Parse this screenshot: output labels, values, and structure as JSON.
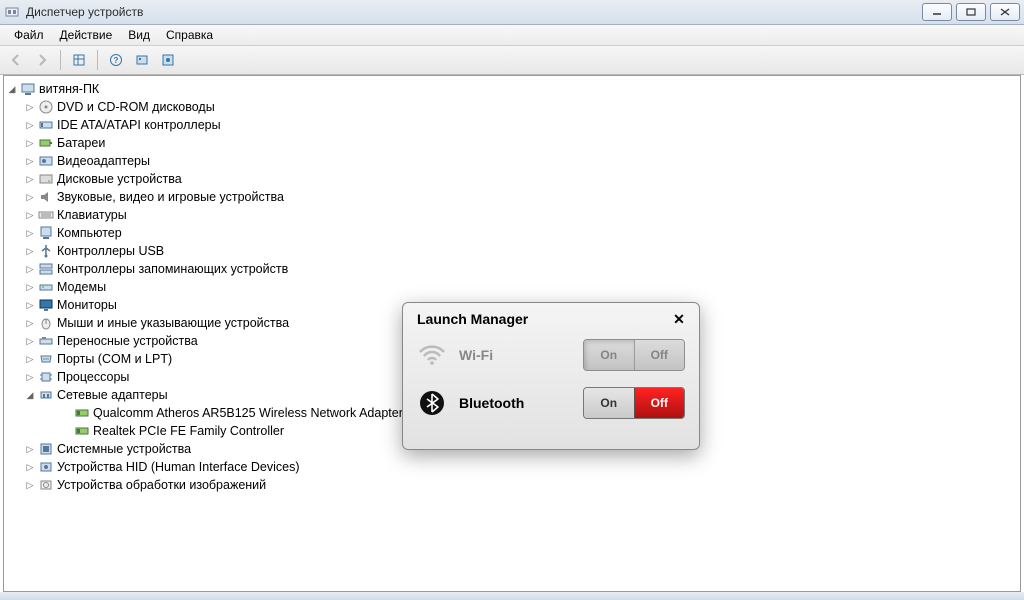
{
  "window": {
    "title": "Диспетчер устройств"
  },
  "menu": {
    "file": "Файл",
    "action": "Действие",
    "view": "Вид",
    "help": "Справка"
  },
  "tree": {
    "root": "витяня-ПК",
    "items": [
      "DVD и CD-ROM дисководы",
      "IDE ATA/ATAPI контроллеры",
      "Батареи",
      "Видеоадаптеры",
      "Дисковые устройства",
      "Звуковые, видео и игровые устройства",
      "Клавиатуры",
      "Компьютер",
      "Контроллеры USB",
      "Контроллеры запоминающих устройств",
      "Модемы",
      "Мониторы",
      "Мыши и иные указывающие устройства",
      "Переносные устройства",
      "Порты (COM и LPT)",
      "Процессоры",
      "Сетевые адаптеры",
      "Системные устройства",
      "Устройства HID (Human Interface Devices)",
      "Устройства обработки изображений"
    ],
    "network_children": [
      "Qualcomm Atheros AR5B125 Wireless Network Adapter",
      "Realtek PCIe FE Family Controller"
    ]
  },
  "launch_manager": {
    "title": "Launch Manager",
    "wifi": {
      "label": "Wi-Fi",
      "on": "On",
      "off": "Off"
    },
    "bluetooth": {
      "label": "Bluetooth",
      "on": "On",
      "off": "Off"
    }
  }
}
